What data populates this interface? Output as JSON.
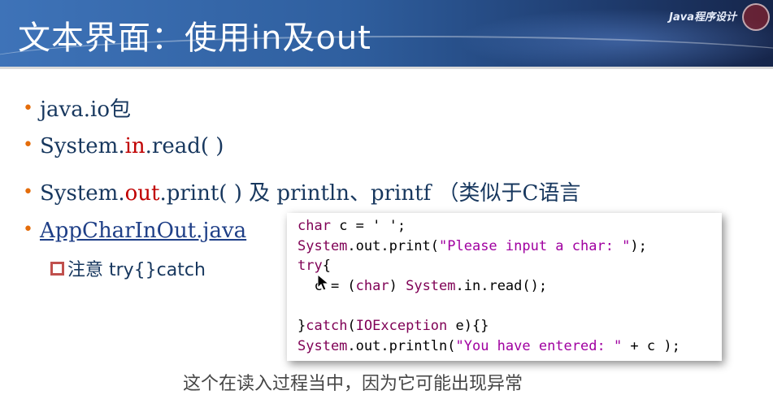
{
  "header": {
    "title": "文本界面：使用in及out",
    "course": "Java程序设计"
  },
  "bullets": {
    "b1": "java.io包",
    "b2_pre": "System.",
    "b2_red": "in",
    "b2_post": ".read( )",
    "b3_pre": "System.",
    "b3_red": "out",
    "b3_post": ".print( ) 及 println、printf （类似于C语言",
    "b4_link": "AppCharInOut.java",
    "sub": "注意 try{}catch"
  },
  "code": {
    "l1_kw": "char",
    "l1_rest": " c = ' ';",
    "l2_sys": "System",
    "l2_mid": ".out.print(",
    "l2_str": "\"Please input a char: \"",
    "l2_end": ");",
    "l3_kw": "try",
    "l3_end": "{",
    "l4_pre": "  c = (",
    "l4_kw": "char",
    "l4_mid": ") ",
    "l4_sys": "System",
    "l4_end": ".in.read();",
    "l6_pre": "}",
    "l6_kw": "catch",
    "l6_mid": "(",
    "l6_cls": "IOException",
    "l6_end": " e){}",
    "l7_sys": "System",
    "l7_mid": ".out.println(",
    "l7_str": "\"You have entered: \"",
    "l7_end": " + c );"
  },
  "caption": "这个在读入过程当中，因为它可能出现异常",
  "colors": {
    "bullet_dot": "#e46c0a",
    "text": "#17375e",
    "highlight": "#c00000",
    "keyword": "#7f0055",
    "string": "#a000a0"
  }
}
